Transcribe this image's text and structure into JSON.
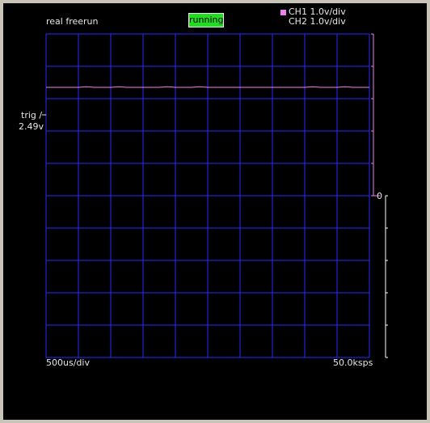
{
  "header": {
    "mode_label": "real freerun",
    "status_label": "running",
    "ch1_label": "CH1 1.0v/div",
    "ch2_label": "CH2 1.0v/div"
  },
  "trigger": {
    "line1": "trig /",
    "line2": "2.49v"
  },
  "footer": {
    "timebase": "500us/div",
    "sample_rate": "50.0ksps"
  },
  "scale": {
    "zero_marker": "0"
  },
  "colors": {
    "background": "#000000",
    "grid": "#2a2aff",
    "ch1": "#f07ff0",
    "ch2": "#ffffff",
    "status_bg": "#22dd22"
  },
  "chart_data": {
    "type": "line",
    "grid": true,
    "x_divisions": 10,
    "y_divisions": 10,
    "series": [
      {
        "name": "CH1",
        "values": [
          3.35,
          3.35,
          3.35,
          3.35,
          3.35,
          3.37,
          3.35,
          3.35,
          3.35,
          3.37,
          3.35,
          3.35,
          3.35,
          3.35,
          3.35,
          3.37,
          3.35,
          3.35,
          3.35,
          3.37,
          3.35,
          3.35,
          3.35,
          3.35,
          3.35,
          3.35,
          3.35,
          3.35,
          3.35,
          3.35,
          3.35,
          3.35,
          3.35,
          3.37,
          3.35,
          3.35,
          3.35,
          3.37,
          3.35,
          3.35,
          3.35
        ]
      }
    ]
  }
}
